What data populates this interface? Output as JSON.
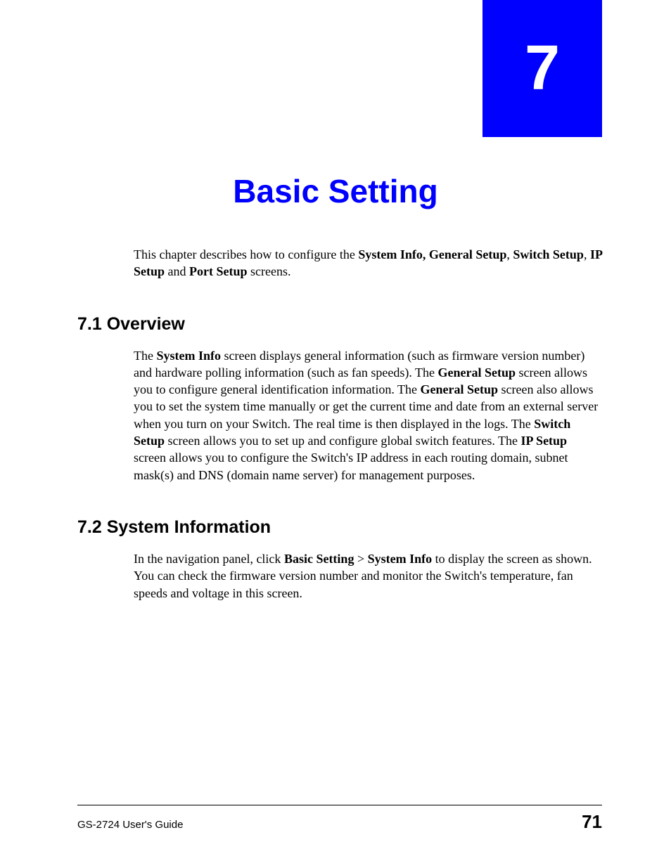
{
  "chapter": {
    "number": "7",
    "title": "Basic Setting"
  },
  "intro": {
    "text_before": "This chapter describes how to configure the ",
    "bold1": "System Info, General Setup",
    "sep1": ", ",
    "bold2": "Switch Setup",
    "sep2": ", ",
    "bold3": "IP Setup",
    "sep3": " and ",
    "bold4": "Port Setup",
    "text_after": " screens."
  },
  "sections": {
    "s1": {
      "heading": "7.1  Overview",
      "p_a": "The ",
      "p_b": "System Info",
      "p_c": " screen displays general information (such as firmware version number) and hardware polling information (such as fan speeds). The ",
      "p_d": "General Setup",
      "p_e": " screen allows you to configure general identification information. The ",
      "p_f": "General Setup",
      "p_g": " screen also allows you to set the system time manually or get the current time and date from an external server when you turn on your Switch. The real time is then displayed in the logs. The ",
      "p_h": "Switch Setup",
      "p_i": " screen allows you to set up and configure global switch features. The ",
      "p_j": "IP Setup",
      "p_k": " screen allows you to configure the Switch's IP address in each routing domain, subnet mask(s) and DNS (domain name server) for management purposes."
    },
    "s2": {
      "heading": "7.2  System Information",
      "p_a": "In the navigation panel, click ",
      "p_b": "Basic Setting",
      "p_c": " > ",
      "p_d": "System Info",
      "p_e": " to display the screen as shown. You can check the firmware version number and monitor the Switch's temperature, fan speeds and voltage in this screen."
    }
  },
  "footer": {
    "guide": "GS-2724 User's Guide",
    "page": "71"
  }
}
